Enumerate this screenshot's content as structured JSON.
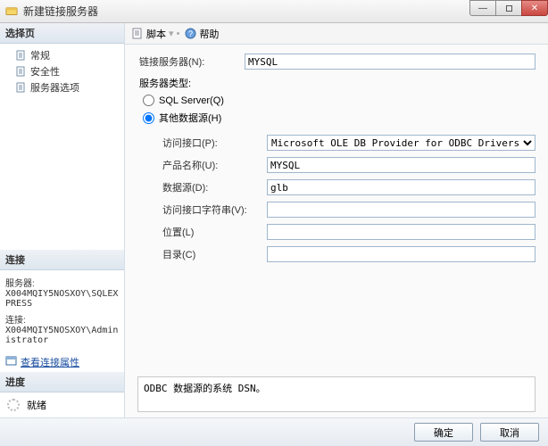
{
  "window": {
    "title": "新建链接服务器"
  },
  "winbtns": {
    "min": "—",
    "close": "✕"
  },
  "left": {
    "selectPage": {
      "header": "选择页"
    },
    "tree": {
      "general": "常规",
      "security": "安全性",
      "options": "服务器选项"
    },
    "connection": {
      "header": "连接",
      "serverLabel": "服务器:",
      "serverValue": "X004MQIY5NOSXOY\\SQLEXPRESS",
      "connLabel": "连接:",
      "connValue": "X004MQIY5NOSXOY\\Administrator",
      "viewProps": "查看连接属性"
    },
    "progress": {
      "header": "进度",
      "ready": "就绪"
    }
  },
  "toolbar": {
    "script": "脚本",
    "help": "帮助",
    "sep": "▾  •"
  },
  "form": {
    "linkedServer": {
      "label": "链接服务器(N):",
      "value": "MYSQL"
    },
    "serverType": {
      "label": "服务器类型:"
    },
    "radioSql": "SQL Server(Q)",
    "radioOther": "其他数据源(H)",
    "provider": {
      "label": "访问接口(P):",
      "value": "Microsoft OLE DB Provider for ODBC Drivers"
    },
    "productName": {
      "label": "产品名称(U):",
      "value": "MYSQL"
    },
    "dataSource": {
      "label": "数据源(D):",
      "value": "glb"
    },
    "providerString": {
      "label": "访问接口字符串(V):",
      "value": ""
    },
    "location": {
      "label": "位置(L)",
      "value": ""
    },
    "catalog": {
      "label": "目录(C)",
      "value": ""
    }
  },
  "hint": "ODBC 数据源的系统 DSN。",
  "footer": {
    "ok": "确定",
    "cancel": "取消"
  }
}
